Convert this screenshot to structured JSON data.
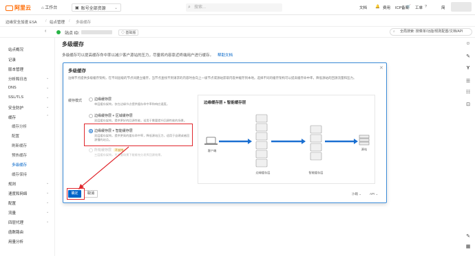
{
  "topbar": {
    "logo_text": "阿里云",
    "workspace": "工作台",
    "account": "账号全部资源",
    "search_placeholder": "搜索...",
    "links": [
      "文档",
      "费用",
      "ICP备案",
      "工单"
    ],
    "lang": "简"
  },
  "breadcrumb": {
    "items": [
      "边缘安全加速 ESA",
      "站点管理",
      "多级缓存"
    ]
  },
  "site": {
    "label": "站点 ID:",
    "plan": "基础版",
    "global_search": "全局搜索: 搜菜单/功能/规则配置/文档/API"
  },
  "sidebar": {
    "items": [
      {
        "label": "站点概况"
      },
      {
        "label": "记录"
      },
      {
        "label": "版本管理"
      },
      {
        "label": "分析和日志"
      },
      {
        "label": "DNS"
      },
      {
        "label": "SSL/TLS"
      },
      {
        "label": "安全防护"
      },
      {
        "label": "缓存"
      },
      {
        "label": "缓存分析"
      },
      {
        "label": "配置"
      },
      {
        "label": "刷新缓存"
      },
      {
        "label": "预热缓存"
      },
      {
        "label": "多级缓存"
      },
      {
        "label": "缓存保持"
      },
      {
        "label": "规则"
      },
      {
        "label": "速度和网络"
      },
      {
        "label": "配置"
      },
      {
        "label": "流量"
      },
      {
        "label": "四层代理"
      },
      {
        "label": "函数路由"
      },
      {
        "label": "用量分析"
      }
    ]
  },
  "page": {
    "title": "多级缓存",
    "desc": "多级缓存可以提高缓存命中率以减少客户源站的压力，尽量将内容靠近终端用户进行缓存。",
    "help_link": "帮助文档"
  },
  "dialog": {
    "title": "多级缓存",
    "desc": "边缘节点提供多级缓存架构，在不同层级的节点间建立缓存，当节点查找不到请求的内容时会向上一级节点或源站获取内容并缓存到本地。选择不同的缓存架构可以提高缓存命中率，降低源站的回源流量和压力。",
    "field_label": "缓存模式",
    "options": [
      {
        "label": "边缘缓存层",
        "desc": "单层缓存架构，仅在边缘节点提供缓存命中率和响应速度。"
      },
      {
        "label": "边缘缓存层 + 区域缓存层",
        "desc": "双层缓存架构，提供更好的回源性能，适用于需要提升回源性能的场景。"
      },
      {
        "label": "边缘缓存层 + 智能缓存层",
        "desc": "双层缓存架构，提供更高的缓存命中率，降低源站压力，适用于自建或者回源慢的站点。"
      },
      {
        "label": "所有缓存层",
        "tag": "不支持",
        "desc": "三层缓存架构，大流量场景下能够充分发挥回源效果。"
      }
    ],
    "diagram_title": "边缘缓存层 + 智能缓存层",
    "diagram_labels": {
      "client": "客户端",
      "edge": "边缘缓存层",
      "smart": "智能缓存层",
      "origin": "源站"
    },
    "ok_label": "确定",
    "cancel_label": "取消",
    "footer_links": [
      "沙箱",
      "API"
    ]
  },
  "colors": {
    "accent": "#0064c8",
    "highlight": "#e0252b",
    "brand": "#ff6a00"
  }
}
